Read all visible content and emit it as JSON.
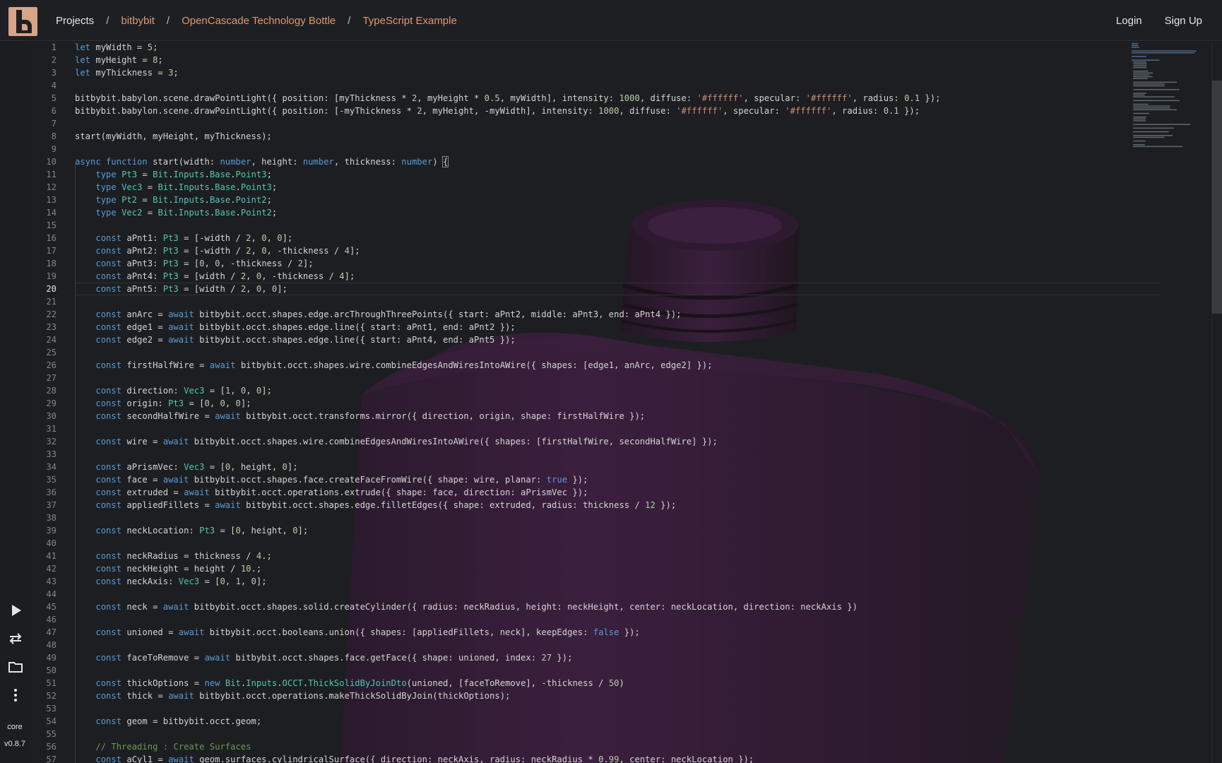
{
  "header": {
    "logo_alt": "bitbybit",
    "breadcrumbs": {
      "home": "Projects",
      "separator": "/",
      "items": [
        "bitbybit",
        "OpenCascade Technology Bottle",
        "TypeScript Example"
      ]
    },
    "login": "Login",
    "signup": "Sign Up"
  },
  "sidebar": {
    "run_icon": "play-icon",
    "swap_icon": "swap-arrows-icon",
    "folder_icon": "folder-icon",
    "more_icon": "more-vertical-icon",
    "core_label": "core",
    "version": "v0.8.7"
  },
  "editor": {
    "active_line": 20,
    "lines": [
      "let myWidth = 5;",
      "let myHeight = 8;",
      "let myThickness = 3;",
      "",
      "bitbybit.babylon.scene.drawPointLight({ position: [myThickness * 2, myHeight * 0.5, myWidth], intensity: 1000, diffuse: '#ffffff', specular: '#ffffff', radius: 0.1 });",
      "bitbybit.babylon.scene.drawPointLight({ position: [-myThickness * 2, myHeight, -myWidth], intensity: 1000, diffuse: '#ffffff', specular: '#ffffff', radius: 0.1 });",
      "",
      "start(myWidth, myHeight, myThickness);",
      "",
      "async function start(width: number, height: number, thickness: number) {",
      "    type Pt3 = Bit.Inputs.Base.Point3;",
      "    type Vec3 = Bit.Inputs.Base.Point3;",
      "    type Pt2 = Bit.Inputs.Base.Point2;",
      "    type Vec2 = Bit.Inputs.Base.Point2;",
      "",
      "    const aPnt1: Pt3 = [-width / 2, 0, 0];",
      "    const aPnt2: Pt3 = [-width / 2, 0, -thickness / 4];",
      "    const aPnt3: Pt3 = [0, 0, -thickness / 2];",
      "    const aPnt4: Pt3 = [width / 2, 0, -thickness / 4];",
      "    const aPnt5: Pt3 = [width / 2, 0, 0];",
      "",
      "    const anArc = await bitbybit.occt.shapes.edge.arcThroughThreePoints({ start: aPnt2, middle: aPnt3, end: aPnt4 });",
      "    const edge1 = await bitbybit.occt.shapes.edge.line({ start: aPnt1, end: aPnt2 });",
      "    const edge2 = await bitbybit.occt.shapes.edge.line({ start: aPnt4, end: aPnt5 });",
      "",
      "    const firstHalfWire = await bitbybit.occt.shapes.wire.combineEdgesAndWiresIntoAWire({ shapes: [edge1, anArc, edge2] });",
      "",
      "    const direction: Vec3 = [1, 0, 0];",
      "    const origin: Pt3 = [0, 0, 0];",
      "    const secondHalfWire = await bitbybit.occt.transforms.mirror({ direction, origin, shape: firstHalfWire });",
      "",
      "    const wire = await bitbybit.occt.shapes.wire.combineEdgesAndWiresIntoAWire({ shapes: [firstHalfWire, secondHalfWire] });",
      "",
      "    const aPrismVec: Vec3 = [0, height, 0];",
      "    const face = await bitbybit.occt.shapes.face.createFaceFromWire({ shape: wire, planar: true });",
      "    const extruded = await bitbybit.occt.operations.extrude({ shape: face, direction: aPrismVec });",
      "    const appliedFillets = await bitbybit.occt.shapes.edge.filletEdges({ shape: extruded, radius: thickness / 12 });",
      "",
      "    const neckLocation: Pt3 = [0, height, 0];",
      "",
      "    const neckRadius = thickness / 4.;",
      "    const neckHeight = height / 10.;",
      "    const neckAxis: Vec3 = [0, 1, 0];",
      "",
      "    const neck = await bitbybit.occt.shapes.solid.createCylinder({ radius: neckRadius, height: neckHeight, center: neckLocation, direction: neckAxis })",
      "",
      "    const unioned = await bitbybit.occt.booleans.union({ shapes: [appliedFillets, neck], keepEdges: false });",
      "",
      "    const faceToRemove = await bitbybit.occt.shapes.face.getFace({ shape: unioned, index: 27 });",
      "",
      "    const thickOptions = new Bit.Inputs.OCCT.ThickSolidByJoinDto(unioned, [faceToRemove], -thickness / 50)",
      "    const thick = await bitbybit.occt.operations.makeThickSolidByJoin(thickOptions);",
      "",
      "    const geom = bitbybit.occt.geom;",
      "",
      "    // Threading : Create Surfaces",
      "    const aCyl1 = await geom.surfaces.cylindricalSurface({ direction: neckAxis, radius: neckRadius * 0.99, center: neckLocation });"
    ]
  },
  "colors": {
    "accent": "#e0986e",
    "background": "#1d1e21",
    "keyword": "#569cd6",
    "type": "#4ec9b0",
    "number": "#b5cea8",
    "string": "#ce9178",
    "comment": "#6a9955",
    "bottle": "#3a1f3c"
  }
}
